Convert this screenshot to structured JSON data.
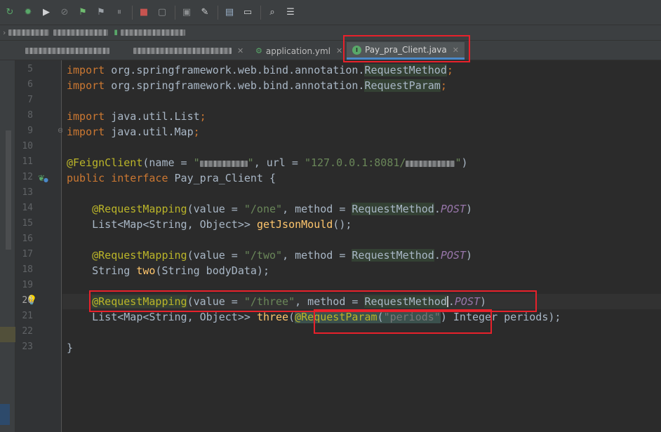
{
  "toolbar": {
    "buttons": [
      {
        "icon": "rerun-icon",
        "glyph": "↻",
        "color": "#59a869"
      },
      {
        "icon": "debug-icon",
        "glyph": "✹",
        "color": "#59a869"
      },
      {
        "icon": "run-coverage-icon",
        "glyph": "▶",
        "color": "#cfd1d3"
      },
      {
        "icon": "profile-icon",
        "glyph": "⊘",
        "color": "#777a7c"
      },
      {
        "icon": "run-config-1-icon",
        "glyph": "⚑",
        "color": "#6fbb6f"
      },
      {
        "icon": "run-config-2-icon",
        "glyph": "⚑",
        "color": "#9aa0a6"
      },
      {
        "icon": "pause-icon",
        "glyph": "⏸",
        "color": "#777a7c"
      },
      {
        "icon": "stop-icon",
        "glyph": "■",
        "color": "#c75450"
      },
      {
        "icon": "build-artifact-icon",
        "glyph": "▢",
        "color": "#8a8d8f"
      },
      {
        "icon": "sdk-icon",
        "glyph": "▣",
        "color": "#8a8d8f"
      },
      {
        "icon": "settings-wrench-icon",
        "glyph": "✎",
        "color": "#cfd1d3"
      },
      {
        "icon": "project-structure-icon",
        "glyph": "▤",
        "color": "#9ab0c8"
      },
      {
        "icon": "terminal-icon",
        "glyph": "▭",
        "color": "#cfd1d3"
      },
      {
        "icon": "search-icon",
        "glyph": "⌕",
        "color": "#cfd1d3"
      },
      {
        "icon": "vcs-icon",
        "glyph": "☰",
        "color": "#cfd1d3"
      }
    ]
  },
  "tabs": [
    {
      "label": "application.yml",
      "icon": "yaml-config-icon"
    },
    {
      "label": "Pay_pra_Client.java",
      "icon": "java-interface-icon"
    }
  ],
  "gutter": {
    "line_numbers": [
      "5",
      "6",
      "7",
      "8",
      "9",
      "10",
      "11",
      "12",
      "13",
      "14",
      "15",
      "16",
      "17",
      "18",
      "19",
      "20",
      "21",
      "22",
      "23"
    ],
    "current_line": "20"
  },
  "code": {
    "l5": {
      "kw": "import",
      "pkg": " org.springframework.web.bind.annotation.",
      "cls": "RequestMethod",
      "end": ";"
    },
    "l6": {
      "kw": "import",
      "pkg": " org.springframework.web.bind.annotation.",
      "cls": "RequestParam",
      "end": ";"
    },
    "l8": {
      "kw": "import",
      "pkg": " java.util.List",
      "end": ";"
    },
    "l9": {
      "kw": "import",
      "pkg": " java.util.Map",
      "end": ";"
    },
    "l11": {
      "ann": "@FeignClient",
      "a": "(name = ",
      "q1": "\"",
      "q2": "\"",
      "b": ", url = ",
      "url": "\"127.0.0.1:8081/",
      "q3": "\"",
      "c": ")"
    },
    "l12": {
      "kw1": "public",
      "kw2": "interface",
      "name": " Pay_pra_Client {"
    },
    "l14": {
      "ann": "@RequestMapping",
      "a": "(value = ",
      "path": "\"/one\"",
      "b": ", method = ",
      "cls": "RequestMethod",
      "dot": ".",
      "post": "POST",
      "c": ")"
    },
    "l15": {
      "type": "List<Map<String, Object>> ",
      "fn": "getJsonMould",
      "c": "();"
    },
    "l17": {
      "ann": "@RequestMapping",
      "a": "(value = ",
      "path": "\"/two\"",
      "b": ", method = ",
      "cls": "RequestMethod",
      "dot": ".",
      "post": "POST",
      "c": ")"
    },
    "l18": {
      "type": "String ",
      "fn": "two",
      "c": "(String bodyData);"
    },
    "l20": {
      "ann": "@RequestMapping",
      "a": "(value = ",
      "path": "\"/three\"",
      "b": ", method = ",
      "cls": "RequestMethod",
      "dot": ".",
      "post": "POST",
      "c": ")"
    },
    "l21": {
      "type": "List<Map<String, Object>> ",
      "fn": "three",
      "p1": "(",
      "ann": "@RequestParam",
      "p2": "(",
      "str": "\"periods\"",
      "p3": ") Integer periods);"
    },
    "l23": {
      "brace": "}"
    }
  }
}
